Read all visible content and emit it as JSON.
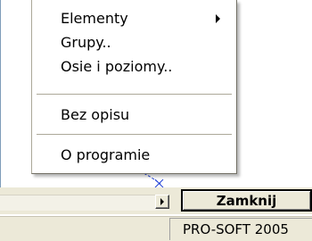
{
  "menu": {
    "items": [
      {
        "label": "Elementy",
        "has_submenu": true
      },
      {
        "label": "Grupy.."
      },
      {
        "label": "Osie i poziomy.."
      },
      {
        "label": "Bez opisu"
      },
      {
        "label": "O programie"
      }
    ]
  },
  "toolbar": {
    "close_label": "Zamknij"
  },
  "status": {
    "text": "PRO-SOFT 2005"
  },
  "colors": {
    "window_face": "#ece9d8",
    "menu_background": "#ffffff",
    "curve": "#1f3fd6",
    "menu_separator": "#aca899"
  },
  "icons": {
    "submenu": "chevron-right-icon",
    "scroll_right": "scroll-right-arrow-icon"
  }
}
